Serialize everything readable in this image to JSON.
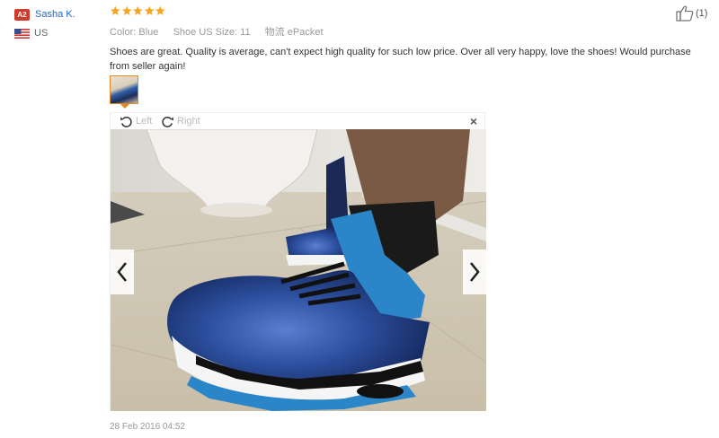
{
  "reviewer": {
    "level_badge": "A2",
    "name": "Sasha K.",
    "country": "US",
    "colors": {
      "badge": "#d23b2b",
      "name": "#2266cc"
    }
  },
  "review": {
    "rating_stars": 5,
    "star_color": "#f5a623",
    "attributes": [
      {
        "label": "Color:",
        "value": "Blue"
      },
      {
        "label": "Shoe US Size:",
        "value": "11"
      },
      {
        "label": "物流",
        "value": "ePacket"
      }
    ],
    "text": "Shoes are great. Quality is average, can't expect high quality for such low price. Over all very happy, love the shoes! Would purchase from seller again!",
    "timestamp": "28 Feb 2016 04:52"
  },
  "viewer": {
    "rotate_left_label": "Left",
    "rotate_right_label": "Right",
    "close_symbol": "×"
  },
  "helpful": {
    "count_label": "(1)",
    "icon": "thumbs-up-icon"
  }
}
